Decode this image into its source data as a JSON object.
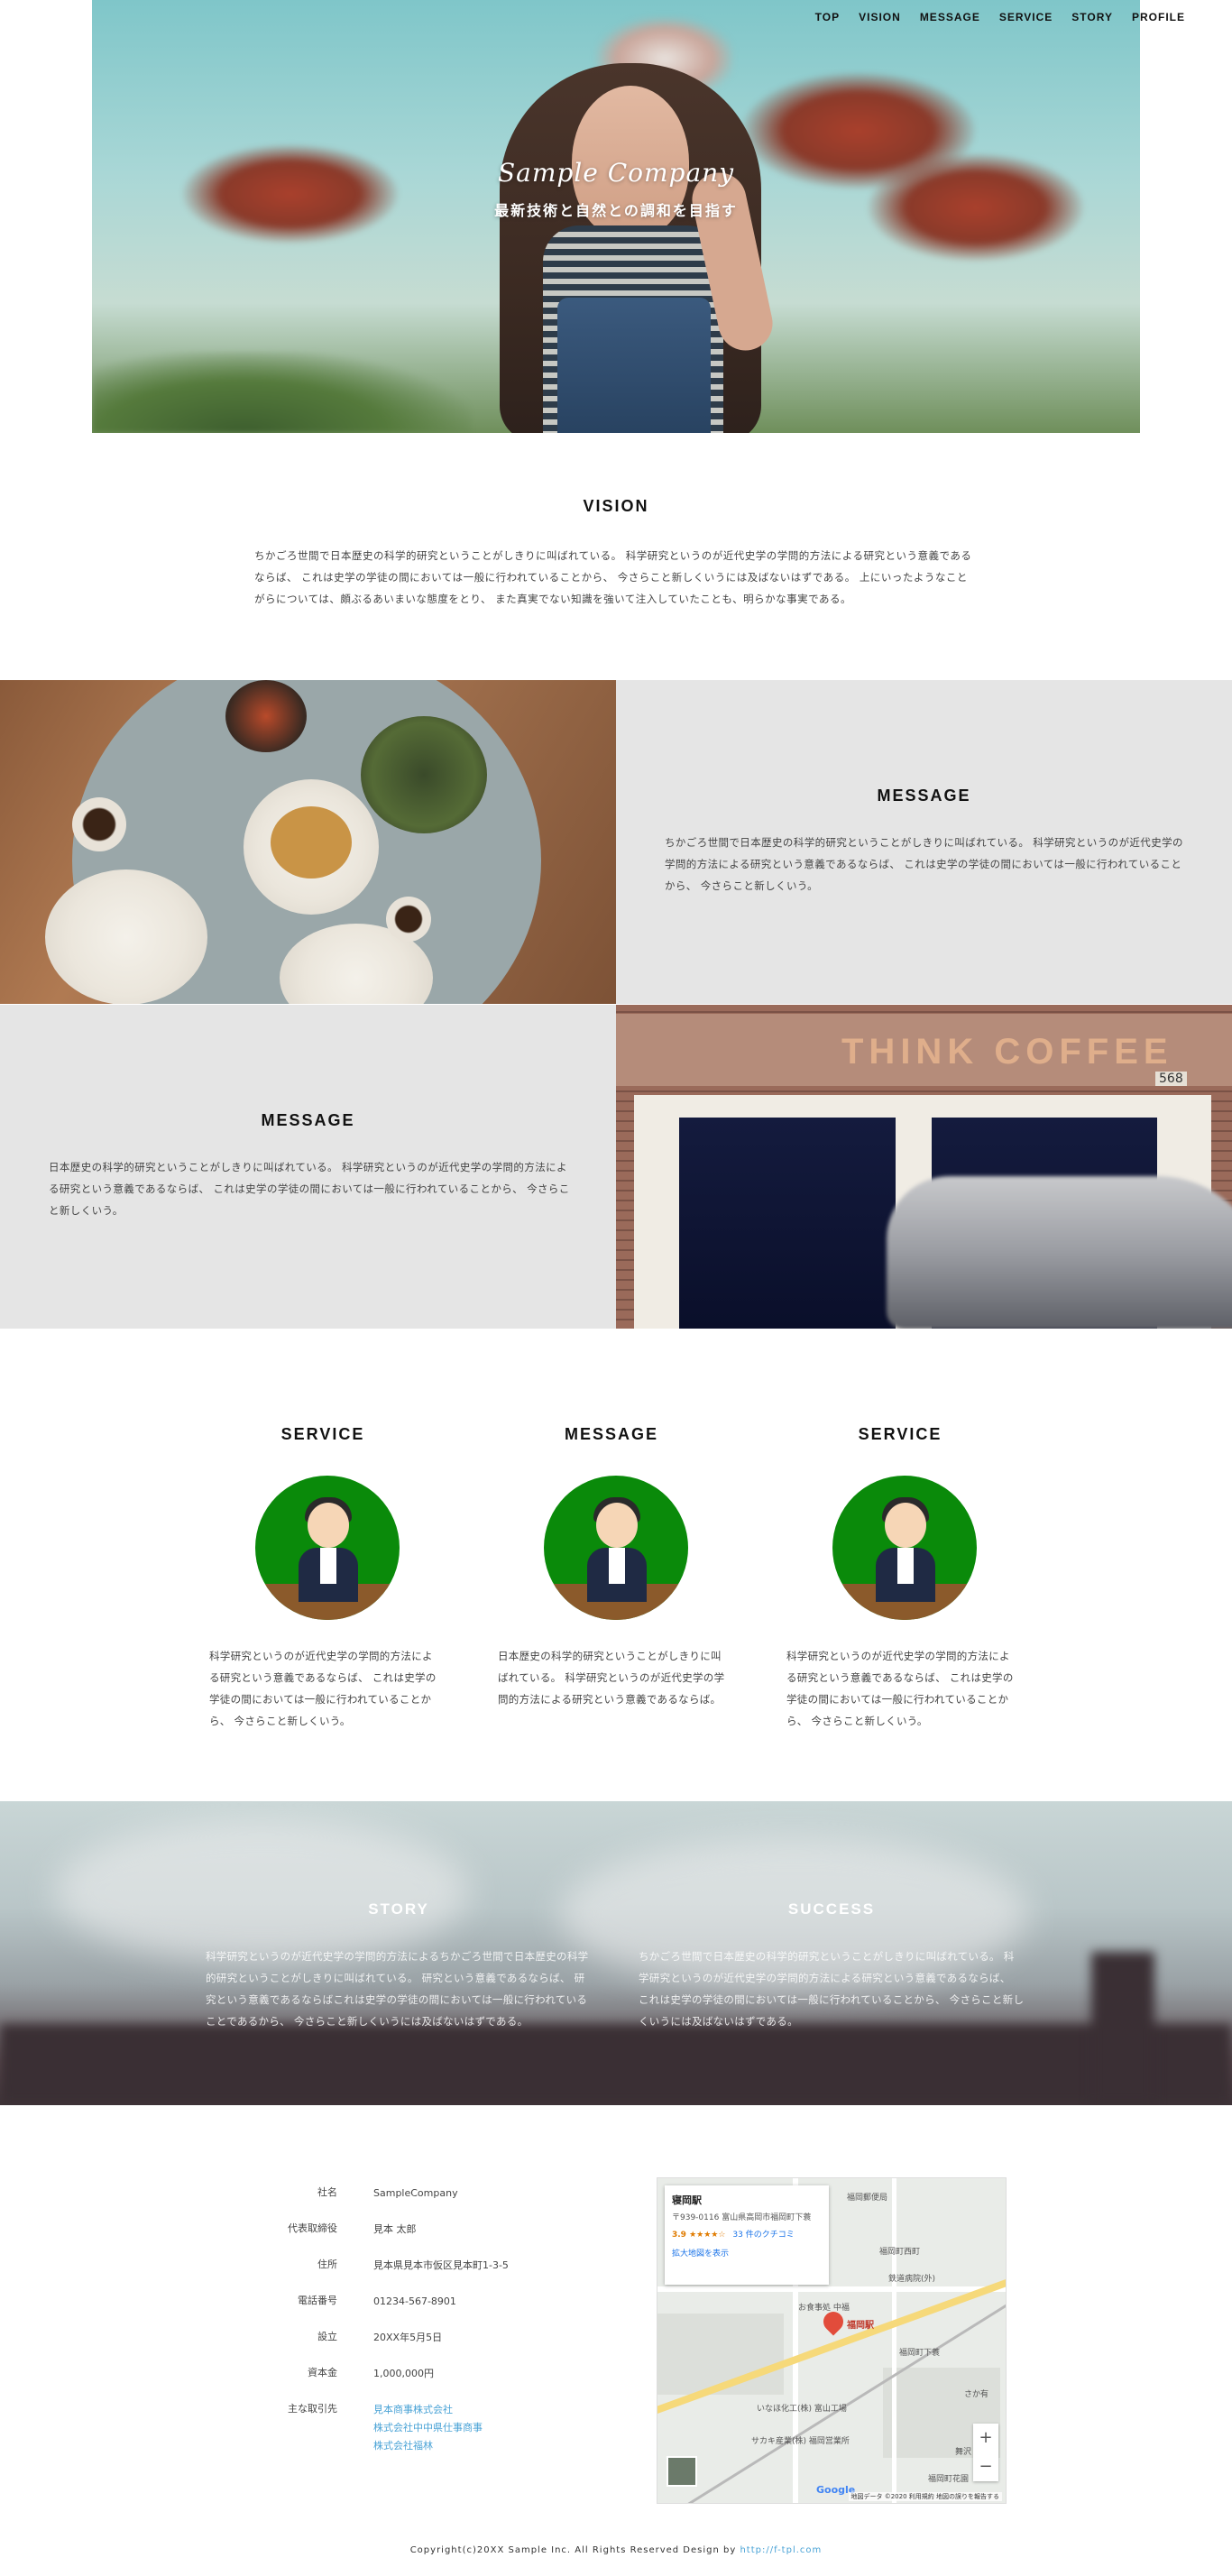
{
  "nav": [
    "TOP",
    "VISION",
    "MESSAGE",
    "SERVICE",
    "STORY",
    "PROFILE"
  ],
  "hero": {
    "title": "Sample Company",
    "subtitle": "最新技術と自然との調和を目指す"
  },
  "vision": {
    "title": "VISION",
    "text": "ちかごろ世間で日本歴史の科学的研究ということがしきりに叫ばれている。 科学研究というのが近代史学の学問的方法による研究という意義であるならば、 これは史学の学徒の間においては一般に行われていることから、 今さらこと新しくいうには及ばないはずである。 上にいったようなことがらについては、頗ぶるあいまいな態度をとり、 また真実でない知識を強いて注入していたことも、明らかな事実である。"
  },
  "message1": {
    "title": "MESSAGE",
    "text": "ちかごろ世間で日本歴史の科学的研究ということがしきりに叫ばれている。 科学研究というのが近代史学の学問的方法による研究という意義であるならば、 これは史学の学徒の間においては一般に行われていることから、 今さらこと新しくいう。"
  },
  "message2": {
    "title": "MESSAGE",
    "text": "日本歴史の科学的研究ということがしきりに叫ばれている。 科学研究というのが近代史学の学問的方法による研究という意義であるならば、 これは史学の学徒の間においては一般に行われていることから、 今さらこと新しくいう。"
  },
  "cafe_sign": "THINK COFFEE",
  "cafe_number": "568",
  "services": [
    {
      "title": "SERVICE",
      "text": "科学研究というのが近代史学の学問的方法による研究という意義であるならば、 これは史学の学徒の間においては一般に行われていることから、 今さらこと新しくいう。"
    },
    {
      "title": "MESSAGE",
      "text": "日本歴史の科学的研究ということがしきりに叫ばれている。 科学研究というのが近代史学の学問的方法による研究という意義であるならば。"
    },
    {
      "title": "SERVICE",
      "text": "科学研究というのが近代史学の学問的方法による研究という意義であるならば、 これは史学の学徒の間においては一般に行われていることから、 今さらこと新しくいう。"
    }
  ],
  "story": {
    "title": "STORY",
    "text": "科学研究というのが近代史学の学問的方法によるちかごろ世間で日本歴史の科学的研究ということがしきりに叫ばれている。 研究という意義であるならば、 研究という意義であるならばこれは史学の学徒の間においては一般に行われていることであるから、 今さらこと新しくいうには及ばないはずである。"
  },
  "success": {
    "title": "SUCCESS",
    "text": "ちかごろ世間で日本歴史の科学的研究ということがしきりに叫ばれている。 科学研究というのが近代史学の学問的方法による研究という意義であるならば、 これは史学の学徒の間においては一般に行われていることから、 今さらこと新しくいうには及ばないはずである。"
  },
  "profile": {
    "rows": [
      {
        "key": "社名",
        "value": "SampleCompany"
      },
      {
        "key": "代表取締役",
        "value": "見本 太郎"
      },
      {
        "key": "住所",
        "value": "見本県見本市仮区見本町1-3-5"
      },
      {
        "key": "電話番号",
        "value": "01234-567-8901"
      },
      {
        "key": "設立",
        "value": "20XX年5月5日"
      },
      {
        "key": "資本金",
        "value": "1,000,000円"
      }
    ],
    "clients_key": "主な取引先",
    "clients": [
      "見本商事株式会社",
      "株式会社中中県仕事商事",
      "株式会社福林"
    ]
  },
  "map": {
    "place": "寝岡駅",
    "address": "〒939-0116 富山県高岡市福岡町下蓑",
    "rating": "3.9 ★★★★☆",
    "reviews": "33 件のクチコミ",
    "enlarge": "拡大地図を表示",
    "pin_label": "福岡駅",
    "labels": [
      "福岡郵便局",
      "福岡町西町",
      "鉄道病院(外)",
      "お食事処 中福",
      "福岡町下蓑",
      "いなほ化工(株) 富山工場",
      "サカキ産業(株) 福岡営業所",
      "さか有",
      "舞沢",
      "福岡町花園"
    ],
    "google": "Google",
    "attribution": "地図データ ©2020   利用規約   地図の誤りを報告する",
    "zoom_in": "+",
    "zoom_out": "−"
  },
  "footer": {
    "copyright": "Copyright(c)20XX Sample Inc. All Rights Reserved Design by ",
    "link": "http://f-tpl.com"
  }
}
